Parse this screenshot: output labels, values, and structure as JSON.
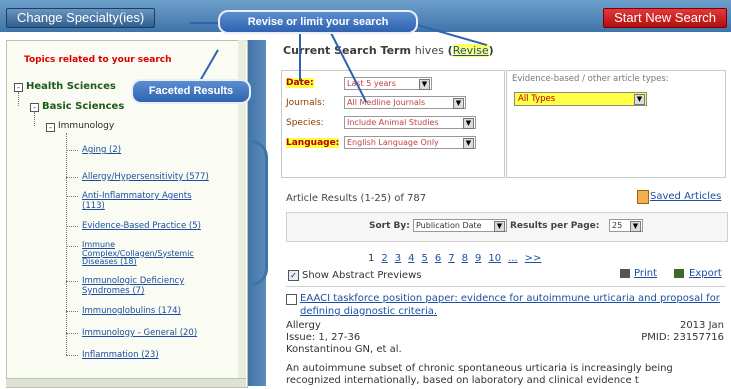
{
  "header": {
    "change_specialty": "Change Specialty(ies)",
    "start_new_search": "Start New Search"
  },
  "callouts": {
    "revise": "Revise or limit your search",
    "faceted": "Faceted Results"
  },
  "sidebar": {
    "topics_heading": "Topics related to your search",
    "root": "Health Sciences",
    "branch": "Basic Sciences",
    "sub": "Immunology",
    "items": [
      {
        "label": "Aging (2)"
      },
      {
        "label": "Allergy/Hypersensitivity (577)"
      },
      {
        "label": "Anti-Inflammatory Agents (113)"
      },
      {
        "label": "Evidence-Based Practice (5)"
      },
      {
        "label": "Immune Complex/Collagen/Systemic Diseases (18)"
      },
      {
        "label": "Immunologic Deficiency Syndromes (7)"
      },
      {
        "label": "Immunoglobulins (174)"
      },
      {
        "label": "Immunology - General (20)"
      },
      {
        "label": "Inflammation (23)"
      }
    ]
  },
  "criteria": {
    "heading_prefix": "Current Search Term",
    "heading_term": "hives",
    "revise_label": "Revise",
    "date_label": "Date:",
    "date_value": "Last 5 years",
    "journals_label": "Journals:",
    "journals_value": "All Medline Journals",
    "species_label": "Species:",
    "species_value": "Include Animal Studies",
    "language_label": "Language:",
    "language_value": "English Language Only",
    "evidence_label": "Evidence-based / other article types:",
    "evidence_value": "All Types"
  },
  "results": {
    "summary": "Article Results (1-25) of 787",
    "saved_articles": "Saved Articles",
    "sort_by_label": "Sort By:",
    "sort_by_value": "Publication Date",
    "per_page_label": "Results per Page:",
    "per_page_value": "25",
    "pages": [
      "1",
      "2",
      "3",
      "4",
      "5",
      "6",
      "7",
      "8",
      "9",
      "10",
      "...",
      ">>"
    ],
    "show_abstract": "Show Abstract Previews",
    "print": "Print",
    "export": "Export"
  },
  "article": {
    "title": "EAACI taskforce position paper: evidence for autoimmune urticaria and proposal for defining diagnostic criteria.",
    "journal": "Allergy",
    "issue": "Issue: 1, 27-36",
    "authors": "Konstantinou GN, et al.",
    "date": "2013 Jan",
    "pmid": "PMID: 23157716",
    "abstract": "An autoimmune subset of chronic spontaneous urticaria is increasingly being recognized internationally, based on laboratory and clinical evidence t"
  }
}
